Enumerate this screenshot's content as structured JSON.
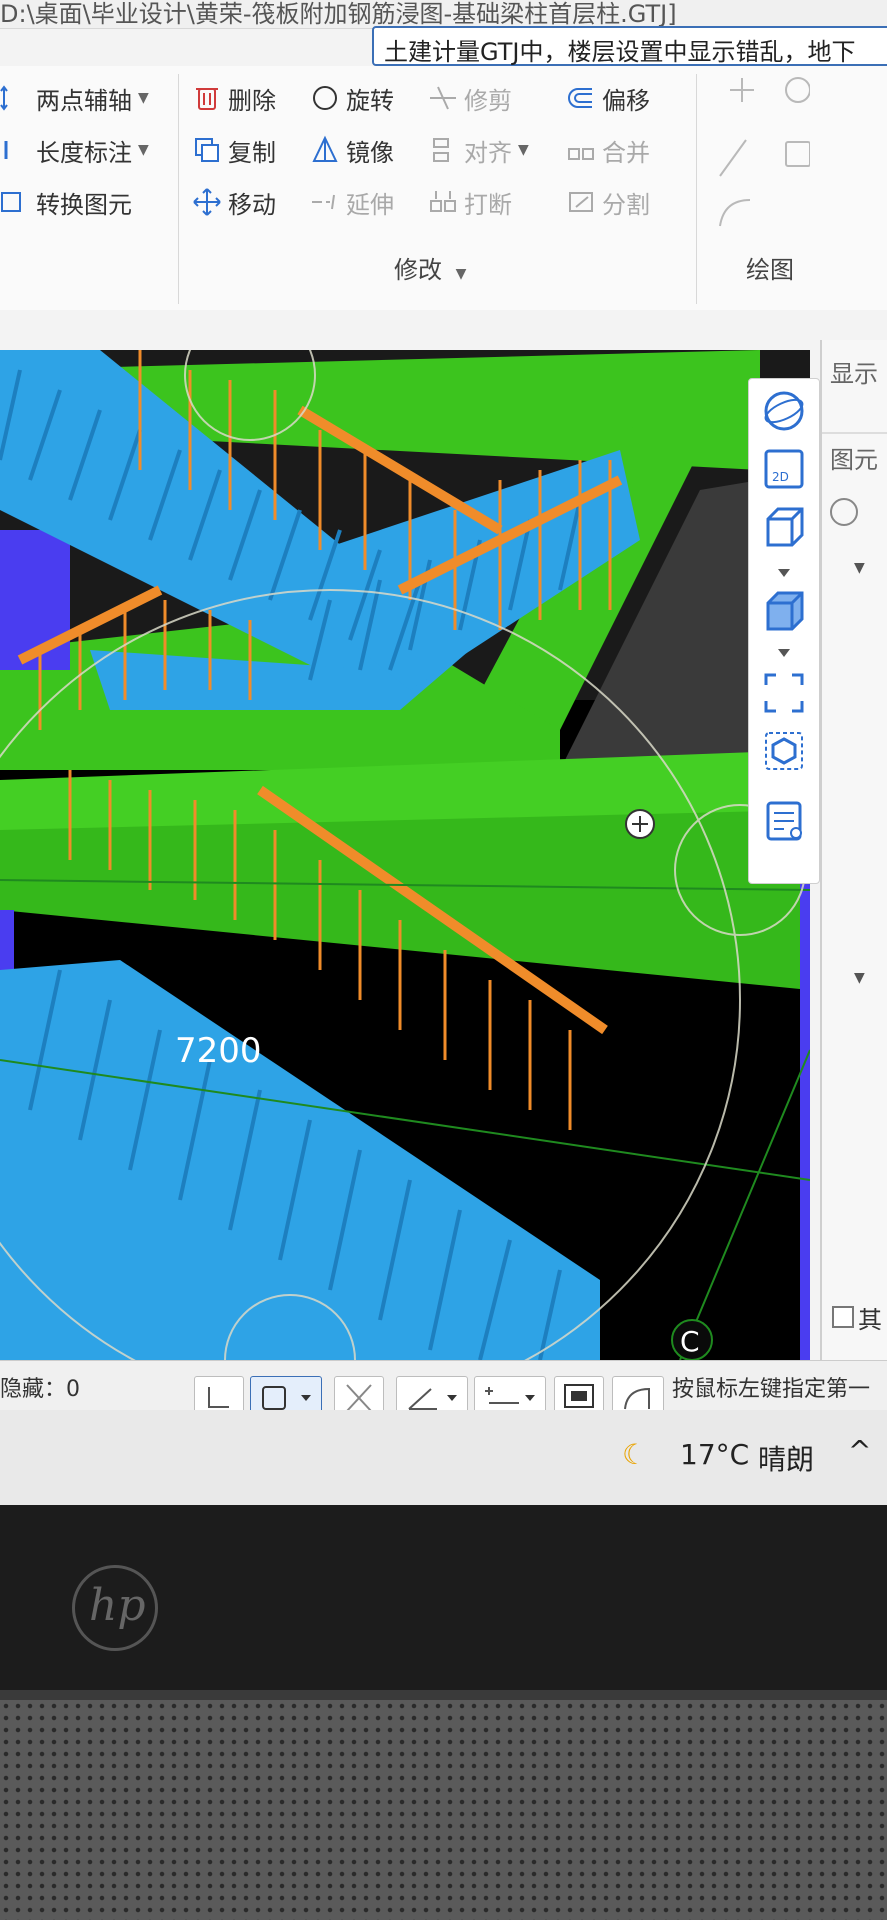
{
  "window": {
    "title_path": "D:\\桌面\\毕业设计\\黄荣-筏板附加钢筋浸图-基础梁柱首层柱.GTJ]",
    "search_text": "土建计量GTJ中，楼层设置中显示错乱，地下"
  },
  "ribbon": {
    "left_group": [
      "两点辅轴",
      "长度标注",
      "转换图元"
    ],
    "modify_group": {
      "col1": [
        "删除",
        "复制",
        "移动"
      ],
      "col2": [
        "旋转",
        "镜像",
        "延伸"
      ],
      "col3": [
        "修剪",
        "对齐",
        "打断"
      ],
      "col4": [
        "偏移",
        "合并",
        "分割"
      ],
      "label": "修改"
    },
    "draw_group_label": "绘图"
  },
  "viewport": {
    "dimension_label": "7200",
    "compass_letter": "C"
  },
  "right_panel": {
    "tab1": "显示",
    "tab2": "图元",
    "checkbox_label": "其"
  },
  "statusbar": {
    "hidden_label": "隐藏：0",
    "hint": "按鼠标左键指定第一"
  },
  "taskbar": {
    "temperature": "17°C",
    "weather": "晴朗"
  },
  "laptop": {
    "brand": "hp"
  },
  "colors": {
    "slab_green": "#3cc41e",
    "stair_blue": "#2ea3e6",
    "rail_orange": "#f08c2a",
    "column_purple": "#4a3df0"
  }
}
